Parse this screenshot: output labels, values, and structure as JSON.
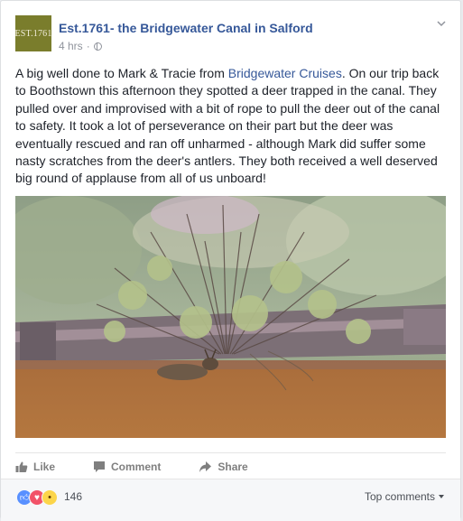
{
  "post": {
    "avatar_text": "EST.1761",
    "page_name": "Est.1761- the Bridgewater Canal in Salford",
    "time": "4 hrs",
    "privacy_icon": "globe-icon",
    "text_before_link": "A big well done to Mark & Tracie from ",
    "link_text": "Bridgewater Cruises",
    "text_after_link": ". On our trip back to Boothstown this afternoon they spotted a deer trapped in the canal. They pulled over and improvised with a bit of rope to pull the deer out of the canal to safety. It took a lot of perseverance on their part but the deer was eventually rescued and ran off unharmed - although Mark did suffer some nasty scratches from the deer's antlers. They both received a well deserved big round of applause from all of us unboard!",
    "photo_icon": "canal-deer-photo"
  },
  "actions": {
    "like_label": "Like",
    "comment_label": "Comment",
    "share_label": "Share"
  },
  "footer": {
    "reaction_count": "146",
    "top_comments_label": "Top comments"
  },
  "colors": {
    "link": "#365899",
    "avatar_bg": "#7a7d2c",
    "like_blue": "#5890ff",
    "love_red": "#f25268",
    "wow_yellow": "#fcd54a"
  }
}
